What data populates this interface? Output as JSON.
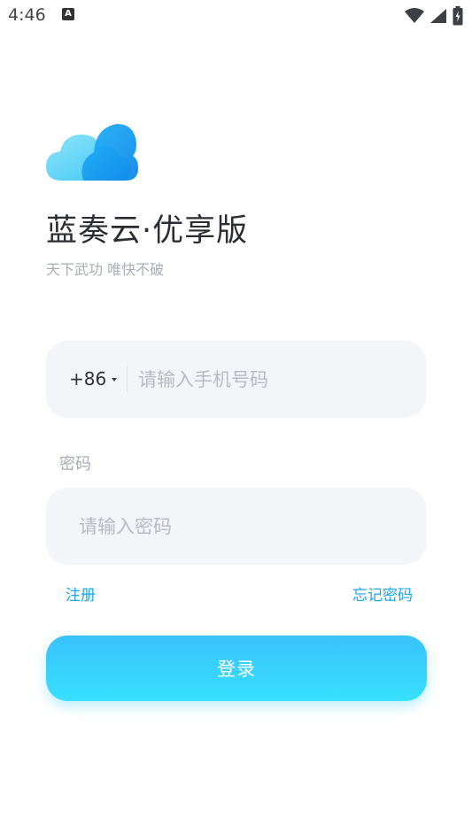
{
  "status_bar": {
    "time": "4:46",
    "notification_icon": "a-notification-icon",
    "wifi_icon": "wifi-icon",
    "signal_icon": "cell-signal-icon",
    "battery_icon": "battery-charging-icon"
  },
  "app": {
    "logo_icon": "cloud-logo-icon",
    "title": "蓝奏云·优享版",
    "slogan": "天下武功 唯快不破"
  },
  "login_form": {
    "country_code": "+86",
    "phone_placeholder": "请输入手机号码",
    "phone_value": "",
    "password_label": "密码",
    "password_placeholder": "请输入密码",
    "password_value": "",
    "register_link": "注册",
    "forgot_password_link": "忘记密码",
    "login_button": "登录"
  },
  "colors": {
    "accent": "#1ba6e8",
    "button_top": "#39c2fb",
    "button_bottom": "#37e0fd",
    "field_bg": "#f4f5f8"
  }
}
